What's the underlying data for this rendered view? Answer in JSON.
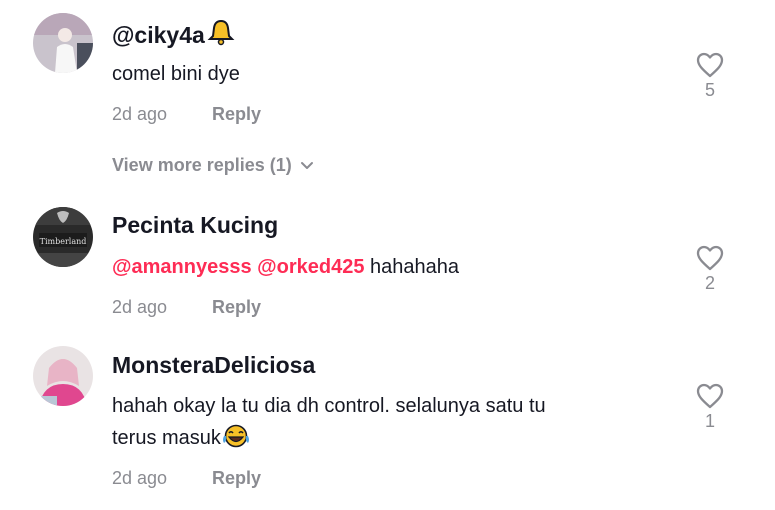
{
  "comments": [
    {
      "author": "@ciky4a",
      "author_icon": "bell-emoji",
      "segments": [
        {
          "text": "comel bini dye",
          "mention": false
        }
      ],
      "time": "2d ago",
      "reply_label": "Reply",
      "likes": "5",
      "view_more": "View more replies (1)"
    },
    {
      "author": "Pecinta Kucing",
      "segments": [
        {
          "text": "@amannyesss",
          "mention": true
        },
        {
          "text": " ",
          "mention": false
        },
        {
          "text": "@orked425",
          "mention": true
        },
        {
          "text": " hahahaha",
          "mention": false
        }
      ],
      "time": "2d ago",
      "reply_label": "Reply",
      "likes": "2"
    },
    {
      "author": "MonsteraDeliciosa",
      "text_line1": "hahah okay la tu dia dh control. selalunya satu tu",
      "text_line2": "terus masuk",
      "text_emoji": "tears-of-joy-emoji",
      "time": "2d ago",
      "reply_label": "Reply",
      "likes": "1"
    }
  ],
  "colors": {
    "mention": "#fe2c55",
    "muted": "#8a8b91",
    "text": "#161823"
  }
}
